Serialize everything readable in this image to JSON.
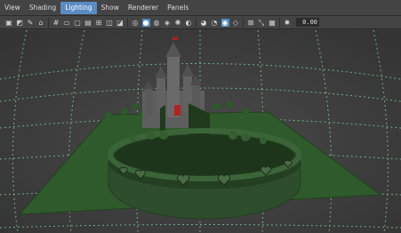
{
  "menu": {
    "items": [
      "View",
      "Shading",
      "Lighting",
      "Show",
      "Renderer",
      "Panels"
    ],
    "active_index": 2
  },
  "toolbar": {
    "icons": [
      "camera-select-icon",
      "camera-attributes-icon",
      "bookmark-icon",
      "image-plane-icon",
      "grid-icon",
      "film-gate-icon",
      "resolution-gate-icon",
      "gate-mask-icon",
      "field-chart-icon",
      "safe-action-icon",
      "safe-title-icon",
      "wireframe-icon",
      "smooth-shade-icon",
      "default-material-icon",
      "textured-icon",
      "use-lights-icon",
      "shadows-icon",
      "screen-space-ao-icon",
      "motion-blur-icon",
      "anti-aliasing-icon",
      "isolate-select-icon",
      "xray-icon",
      "xray-joints-icon",
      "xray-components-icon",
      "exposure-icon"
    ],
    "exposure_value": "0.00",
    "accent_color": "#5a8bc3"
  },
  "viewport": {
    "background_color": "#3a3a3a",
    "grid_color": "#7fd0a6",
    "ground_color": "#2f5a2c",
    "wall_color": "#2e4d2c"
  }
}
